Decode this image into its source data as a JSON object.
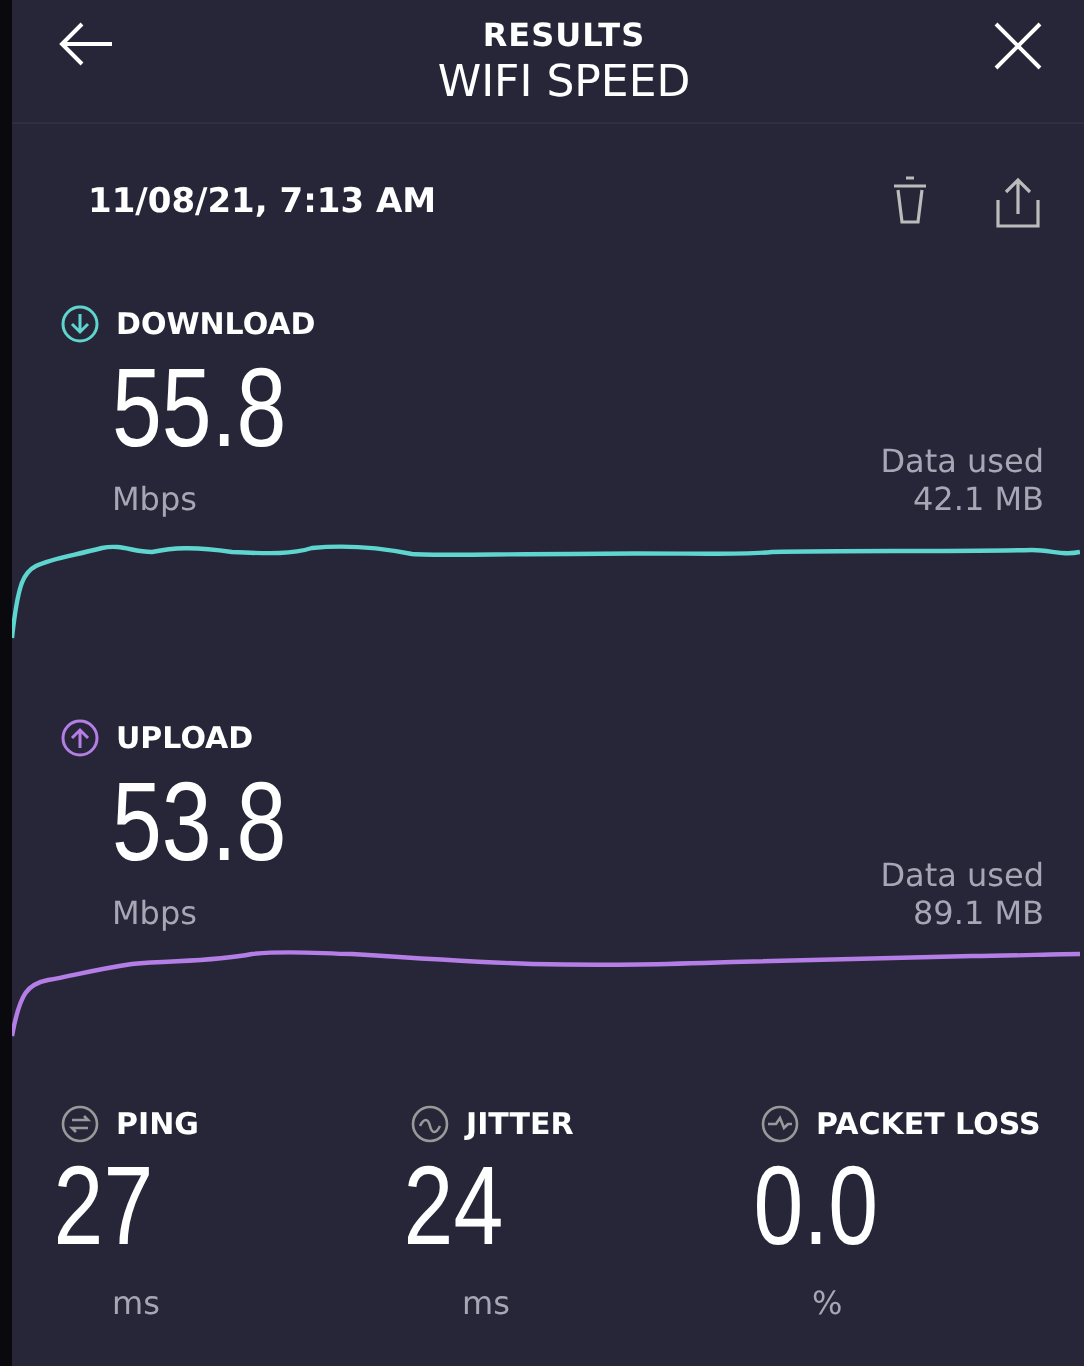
{
  "header": {
    "title": "RESULTS",
    "subtitle": "WIFI SPEED"
  },
  "test": {
    "timestamp": "11/08/21, 7:13 AM"
  },
  "results": [
    {
      "kind": "download",
      "label": "DOWNLOAD",
      "color": "#5fd5cf",
      "value": "55.8",
      "unit": "Mbps",
      "data_label": "Data used",
      "data_value": "42.1 MB"
    },
    {
      "kind": "upload",
      "label": "UPLOAD",
      "color": "#b47ee6",
      "value": "53.8",
      "unit": "Mbps",
      "data_label": "Data used",
      "data_value": "89.1 MB"
    }
  ],
  "stats": [
    {
      "kind": "ping",
      "label": "PING",
      "value": "27",
      "unit": "ms"
    },
    {
      "kind": "jitter",
      "label": "JITTER",
      "value": "24",
      "unit": "ms"
    },
    {
      "kind": "packet_loss",
      "label": "PACKET LOSS",
      "value": "0.0",
      "unit": "%"
    }
  ]
}
